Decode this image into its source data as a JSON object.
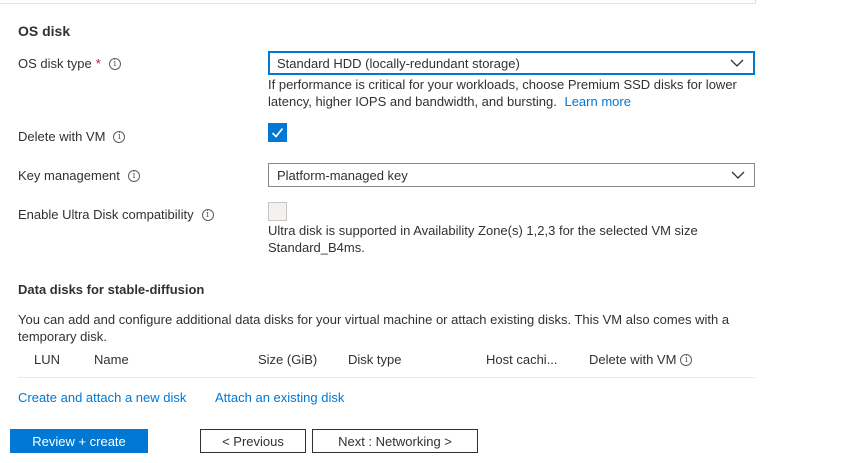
{
  "os_disk": {
    "section_title": "OS disk",
    "disk_type": {
      "label": "OS disk type",
      "required_mark": "*",
      "value": "Standard HDD (locally-redundant storage)",
      "help_text": "If performance is critical for your workloads, choose Premium SSD disks for lower latency, higher IOPS and bandwidth, and bursting.",
      "help_link": "Learn more"
    },
    "delete_with_vm": {
      "label": "Delete with VM",
      "checked": true
    },
    "key_management": {
      "label": "Key management",
      "value": "Platform-managed key"
    },
    "ultra_disk": {
      "label": "Enable Ultra Disk compatibility",
      "checked": false,
      "help_text_line1": "Ultra disk is supported in Availability Zone(s) 1,2,3 for the selected VM size",
      "help_text_line2": "Standard_B4ms."
    }
  },
  "data_disks": {
    "section_title": "Data disks for stable-diffusion",
    "description": "You can add and configure additional data disks for your virtual machine or attach existing disks. This VM also comes with a temporary disk.",
    "columns": [
      "LUN",
      "Name",
      "Size (GiB)",
      "Disk type",
      "Host cachi...",
      "Delete with VM"
    ],
    "create_link": "Create and attach a new disk",
    "attach_link": "Attach an existing disk"
  },
  "footer": {
    "review_create": "Review + create",
    "previous": "< Previous",
    "next": "Next : Networking >"
  },
  "colors": {
    "accent": "#0078d4",
    "required": "#a4262c",
    "text": "#323130"
  },
  "icons": {
    "info": "info-icon",
    "dropdown": "chevron-down-icon",
    "check": "checkmark-icon"
  }
}
